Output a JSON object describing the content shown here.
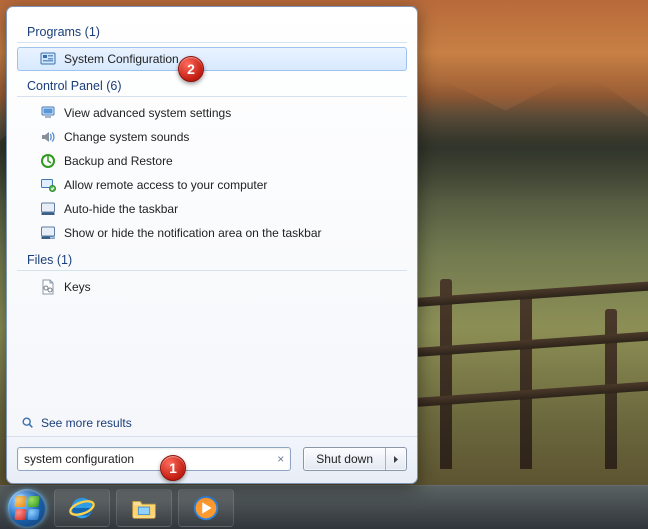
{
  "groups": {
    "programs": {
      "header": "Programs (1)"
    },
    "controlpanel": {
      "header": "Control Panel (6)"
    },
    "files": {
      "header": "Files (1)"
    }
  },
  "results": {
    "programs": [
      {
        "label": "System Configuration"
      }
    ],
    "controlpanel": [
      {
        "label": "View advanced system settings"
      },
      {
        "label": "Change system sounds"
      },
      {
        "label": "Backup and Restore"
      },
      {
        "label": "Allow remote access to your computer"
      },
      {
        "label": "Auto-hide the taskbar"
      },
      {
        "label": "Show or hide the notification area on the taskbar"
      }
    ],
    "files": [
      {
        "label": "Keys"
      }
    ]
  },
  "see_more": "See more results",
  "search": {
    "value": "system configuration",
    "clear": "×"
  },
  "shutdown": {
    "label": "Shut down"
  },
  "annotations": {
    "bubble1": "1",
    "bubble2": "2"
  }
}
